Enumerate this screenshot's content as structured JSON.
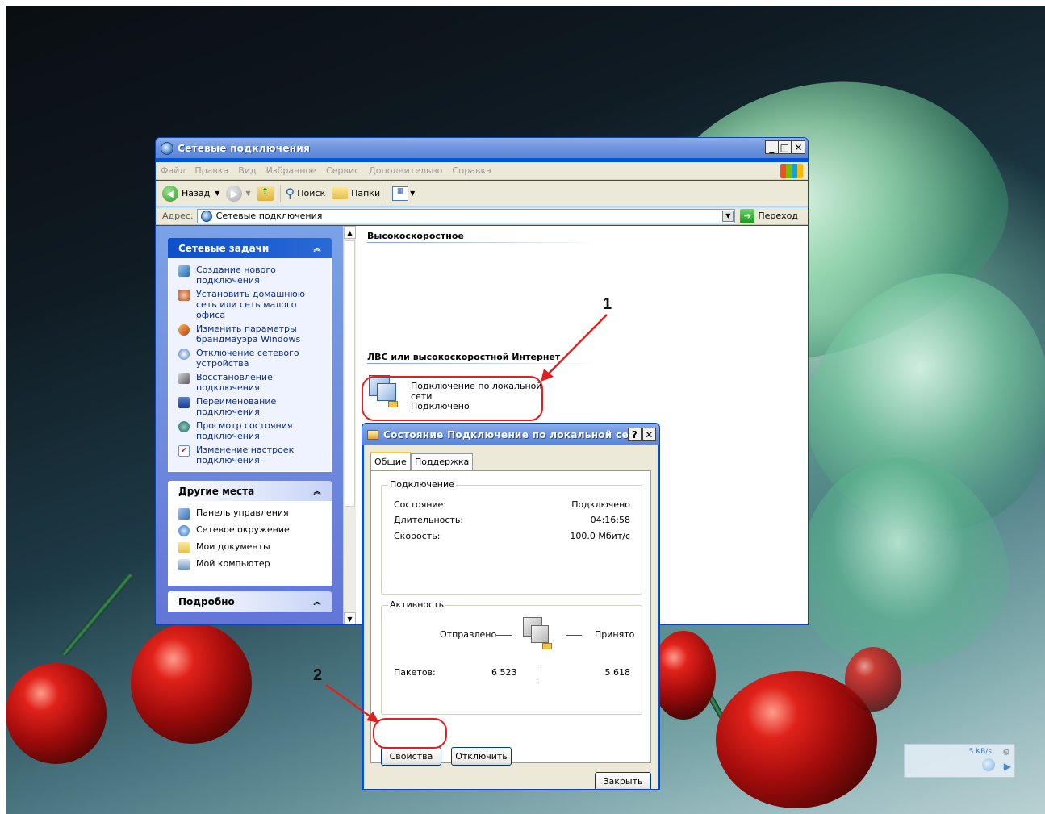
{
  "explorer": {
    "title": "Сетевые подключения",
    "menu": [
      "Файл",
      "Правка",
      "Вид",
      "Избранное",
      "Сервис",
      "Дополнительно",
      "Справка"
    ],
    "toolbar": {
      "back": "Назад",
      "search": "Поиск",
      "folders": "Папки"
    },
    "address": {
      "label": "Адрес:",
      "value": "Сетевые подключения",
      "go": "Переход"
    },
    "taskpane": {
      "network_tasks": {
        "title": "Сетевые задачи",
        "items": [
          "Создание нового подключения",
          "Установить домашнюю сеть или сеть малого офиса",
          "Изменить параметры брандмауэра Windows",
          "Отключение сетевого устройства",
          "Восстановление подключения",
          "Переименование подключения",
          "Просмотр состояния подключения",
          "Изменение настроек подключения"
        ]
      },
      "other_places": {
        "title": "Другие места",
        "items": [
          "Панель управления",
          "Сетевое окружение",
          "Мои документы",
          "Мой компьютер"
        ]
      },
      "details": {
        "title": "Подробно"
      }
    },
    "content": {
      "group_broadband": "Высокоскоростное",
      "group_lan": "ЛВС или высокоскоростной Интернет",
      "connection": {
        "name_line1": "Подключение по локальной",
        "name_line2": "сети",
        "status": "Подключено"
      }
    }
  },
  "dialog": {
    "title": "Состояние Подключение по локальной сети",
    "tabs": [
      "Общие",
      "Поддержка"
    ],
    "connection_group": {
      "title": "Подключение",
      "rows": [
        {
          "label": "Состояние:",
          "value": "Подключено"
        },
        {
          "label": "Длительность:",
          "value": "04:16:58"
        },
        {
          "label": "Скорость:",
          "value": "100.0 Мбит/с"
        }
      ]
    },
    "activity_group": {
      "title": "Активность",
      "sent": "Отправлено",
      "received": "Принято",
      "packets_label": "Пакетов:",
      "packets_sent": "6 523",
      "packets_received": "5 618"
    },
    "buttons": {
      "properties": "Свойства",
      "disconnect": "Отключить",
      "close": "Закрыть"
    }
  },
  "annotations": {
    "one": "1",
    "two": "2"
  },
  "netmeter": {
    "speed": "5 KB/s"
  }
}
